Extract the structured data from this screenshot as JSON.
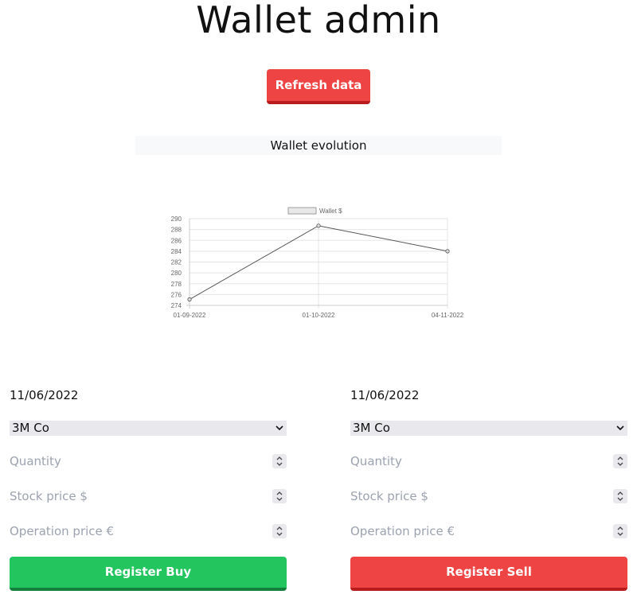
{
  "title": "Wallet admin",
  "refresh_button": "Refresh data",
  "chart_header": "Wallet evolution",
  "chart_data": {
    "type": "line",
    "title": "",
    "categories": [
      "01-09-2022",
      "01-10-2022",
      "04-11-2022"
    ],
    "series": [
      {
        "name": "Wallet $",
        "values": [
          275.1,
          288.7,
          284.0
        ]
      }
    ],
    "ylim": [
      274,
      290
    ],
    "yticks": [
      274,
      276,
      278,
      280,
      282,
      284,
      286,
      288,
      290
    ],
    "grid": true,
    "legend": "top",
    "xlabel": "",
    "ylabel": "",
    "colors": {
      "line": "#555555",
      "grid": "#e5e5e5",
      "axis": "#cccccc",
      "legend_box": "#e8e8e8"
    }
  },
  "buy_form": {
    "date": "11/06/2022",
    "stock": "3M Co",
    "quantity_placeholder": "Quantity",
    "stock_price_placeholder": "Stock price $",
    "operation_price_placeholder": "Operation price €",
    "submit": "Register Buy"
  },
  "sell_form": {
    "date": "11/06/2022",
    "stock": "3M Co",
    "quantity_placeholder": "Quantity",
    "stock_price_placeholder": "Stock price $",
    "operation_price_placeholder": "Operation price €",
    "submit": "Register Sell"
  },
  "colors": {
    "buy": "#22c55e",
    "sell": "#ef4444",
    "placeholder": "#9ca3af"
  }
}
